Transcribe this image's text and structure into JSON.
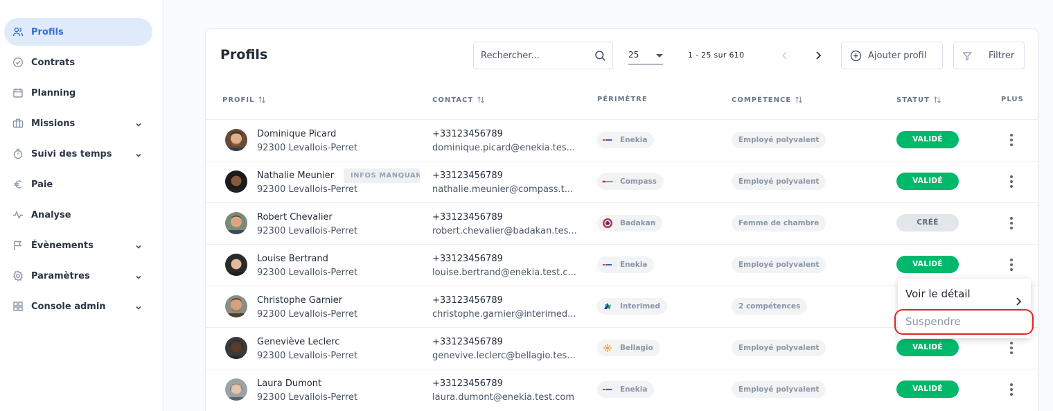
{
  "sidebar": {
    "items": [
      {
        "label": "Profils",
        "icon": "users-icon",
        "active": true,
        "expandable": false
      },
      {
        "label": "Contrats",
        "icon": "check-circle-icon",
        "active": false,
        "expandable": false
      },
      {
        "label": "Planning",
        "icon": "calendar-icon",
        "active": false,
        "expandable": false
      },
      {
        "label": "Missions",
        "icon": "briefcase-icon",
        "active": false,
        "expandable": true
      },
      {
        "label": "Suivi des temps",
        "icon": "stopwatch-icon",
        "active": false,
        "expandable": true
      },
      {
        "label": "Paie",
        "icon": "euro-icon",
        "active": false,
        "expandable": false
      },
      {
        "label": "Analyse",
        "icon": "activity-icon",
        "active": false,
        "expandable": false
      },
      {
        "label": "Évènements",
        "icon": "flag-icon",
        "active": false,
        "expandable": true
      },
      {
        "label": "Paramètres",
        "icon": "settings-icon",
        "active": false,
        "expandable": true
      },
      {
        "label": "Console admin",
        "icon": "grid-icon",
        "active": false,
        "expandable": true
      }
    ]
  },
  "header": {
    "title": "Profils",
    "search_placeholder": "Rechercher...",
    "page_size": "25",
    "page_range": "1 - 25 sur 610",
    "add_label": "Ajouter profil",
    "filter_label": "Filtrer"
  },
  "columns": {
    "profil": "PROFIL",
    "contact": "CONTACT",
    "perimetre": "PÉRIMÈTRE",
    "competence": "COMPÉTENCE",
    "statut": "STATUT",
    "plus": "PLUS"
  },
  "rows": [
    {
      "name": "Dominique Picard",
      "address": "92300 Levallois-Perret",
      "phone": "+33123456789",
      "email": "dominique.picard@enekia.tes...",
      "perimetre": "Enekia",
      "competence": "Employé polyvalent",
      "status": "VALIDÉ",
      "badge": ""
    },
    {
      "name": "Nathalie Meunier",
      "address": "92300 Levallois-Perret",
      "phone": "+33123456789",
      "email": "nathalie.meunier@compass.t...",
      "perimetre": "Compass",
      "competence": "Employé polyvalent",
      "status": "VALIDÉ",
      "badge": "INFOS MANQUANT"
    },
    {
      "name": "Robert Chevalier",
      "address": "92300 Levallois-Perret",
      "phone": "+33123456789",
      "email": "robert.chevalier@badakan.tes...",
      "perimetre": "Badakan",
      "competence": "Femme de chambre",
      "status": "CRÉÉ",
      "badge": ""
    },
    {
      "name": "Louise Bertrand",
      "address": "92300 Levallois-Perret",
      "phone": "+33123456789",
      "email": "louise.bertrand@enekia.test.c...",
      "perimetre": "Enekia",
      "competence": "Employé polyvalent",
      "status": "VALIDÉ",
      "badge": ""
    },
    {
      "name": "Christophe Garnier",
      "address": "92300 Levallois-Perret",
      "phone": "+33123456789",
      "email": "christophe.garnier@interimed...",
      "perimetre": "Interimed",
      "competence": "2 compétences",
      "status": "",
      "badge": ""
    },
    {
      "name": "Geneviève Leclerc",
      "address": "92300 Levallois-Perret",
      "phone": "+33123456789",
      "email": "genevive.leclerc@bellagio.tes...",
      "perimetre": "Bellagio",
      "competence": "Employé polyvalent",
      "status": "VALIDÉ",
      "badge": ""
    },
    {
      "name": "Laura Dumont",
      "address": "92300 Levallois-Perret",
      "phone": "+33123456789",
      "email": "laura.dumont@enekia.test.com",
      "perimetre": "Enekia",
      "competence": "Employé polyvalent",
      "status": "VALIDÉ",
      "badge": ""
    }
  ],
  "context_menu": {
    "detail_label": "Voir le détail",
    "suspend_label": "Suspendre"
  },
  "colors": {
    "accent": "#2f6fd1",
    "active_bg": "#dfeafa",
    "status_valid": "#00b86b",
    "status_created": "#e3e6ea",
    "highlight": "#e02424"
  }
}
